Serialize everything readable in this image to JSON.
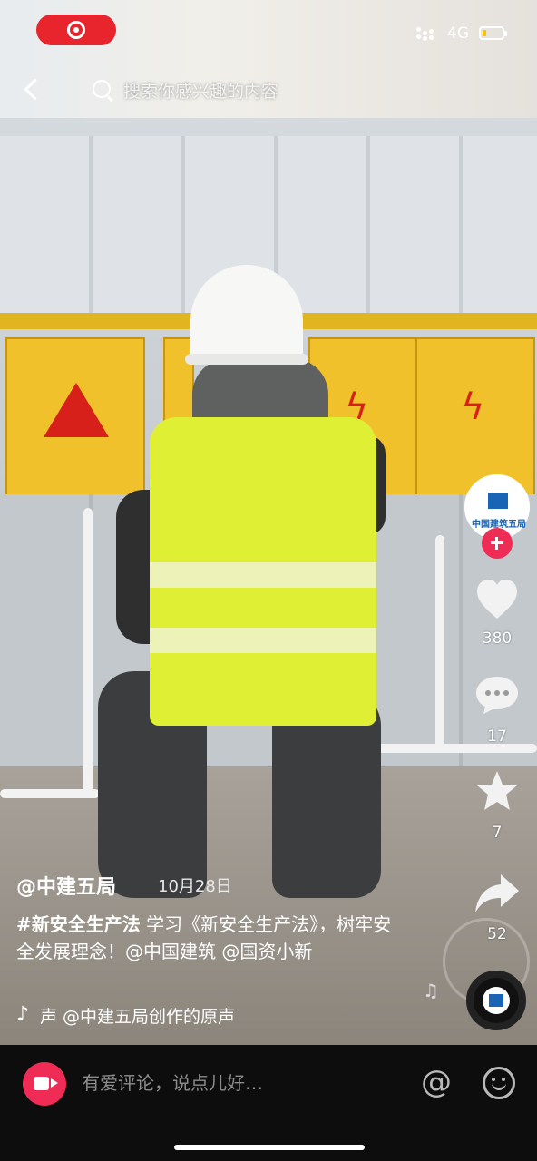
{
  "status_bar": {
    "network": "4G",
    "battery_level": 0.2,
    "recording_indicator": "screen-record"
  },
  "search": {
    "placeholder": "搜索你感兴趣的内容"
  },
  "sidebar": {
    "avatar_text": "中国建筑五局",
    "likes": "380",
    "comments": "17",
    "favorites": "7",
    "shares": "52"
  },
  "video": {
    "author": "@中建五局",
    "date": "10月28日",
    "caption_tag": "#新安全生产法",
    "caption_body": " 学习《新安全生产法》，树牢安全发展理念！@中国建筑 @国资小新",
    "music_note": "♪",
    "music": "声   @中建五局创作的原声"
  },
  "bottom_bar": {
    "comment_placeholder": "有爱评论，说点儿好…",
    "at_symbol": "@"
  },
  "colors": {
    "accent": "#ef2c55",
    "vest": "#dff034",
    "box": "#f0c12b"
  }
}
